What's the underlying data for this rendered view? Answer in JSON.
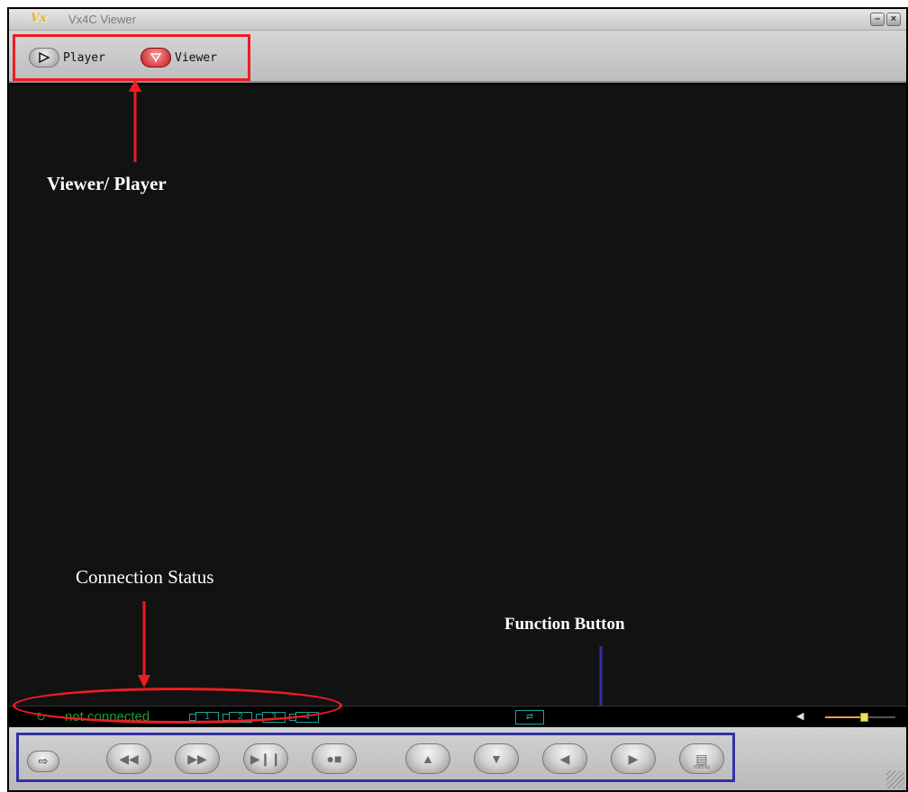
{
  "window": {
    "logo": "Vx",
    "title": "Vx4C Viewer",
    "minimize_glyph": "–",
    "close_glyph": "×"
  },
  "mode_bar": {
    "player_label": "Player",
    "viewer_label": "Viewer",
    "active": "Viewer"
  },
  "annotations": {
    "viewer_player": "Viewer/ Player",
    "connection_status": "Connection Status",
    "function_button": "Function Button"
  },
  "status_bar": {
    "connection_text": "not connected",
    "channels": [
      "1",
      "2",
      "3",
      "4"
    ],
    "volume_level": 0.55
  },
  "function_buttons": [
    {
      "icon": "arrow-right-icon",
      "glyph": "⇨"
    },
    {
      "icon": "rewind-icon",
      "glyph": "◀◀"
    },
    {
      "icon": "fast-forward-icon",
      "glyph": "▶▶"
    },
    {
      "icon": "play-pause-icon",
      "glyph": "▶❙❙"
    },
    {
      "icon": "record-stop-icon",
      "glyph": "●■"
    },
    {
      "icon": "tilt-up-icon",
      "glyph": "▲"
    },
    {
      "icon": "tilt-down-icon",
      "glyph": "▼"
    },
    {
      "icon": "pan-left-icon",
      "glyph": "◀"
    },
    {
      "icon": "pan-right-icon",
      "glyph": "▶"
    },
    {
      "icon": "menu-icon",
      "glyph": "▤",
      "sub": "menu"
    }
  ],
  "colors": {
    "annotation_red": "#ec1c24",
    "annotation_blue": "#3431a6",
    "status_green": "#1f9d2a",
    "channel_teal": "#1da39a"
  }
}
